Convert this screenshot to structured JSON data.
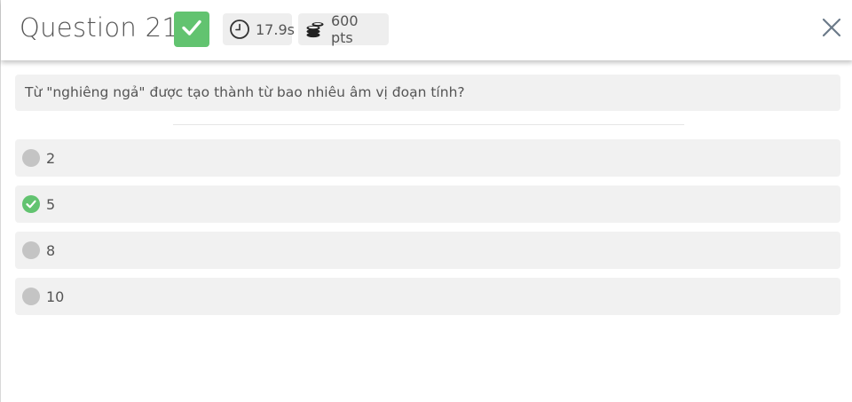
{
  "header": {
    "title": "Question 21",
    "time": "17.9s",
    "points": "600 pts",
    "status": "correct"
  },
  "question": {
    "text": "Từ \"nghiêng ngả\" được tạo thành từ bao nhiêu âm vị đoạn tính?"
  },
  "options": [
    {
      "label": "2",
      "state": "neutral"
    },
    {
      "label": "5",
      "state": "correct"
    },
    {
      "label": "8",
      "state": "neutral"
    },
    {
      "label": "10",
      "state": "neutral"
    }
  ],
  "colors": {
    "correct_green": "#62c370",
    "neutral_grey": "#c4c4c4",
    "option_bg": "#f1f1f1"
  },
  "icons": {
    "status": "checkmark-icon",
    "time": "clock-icon",
    "points": "coins-icon",
    "close": "close-icon"
  }
}
